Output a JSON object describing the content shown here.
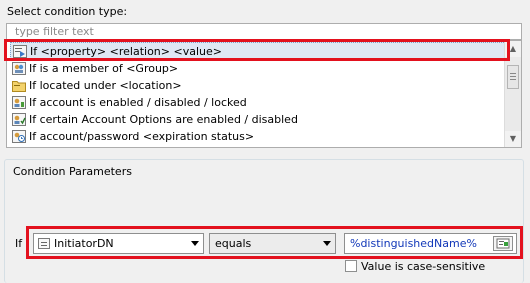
{
  "condition_type": {
    "label": "Select condition type:",
    "filter_placeholder": "type filter text",
    "items": [
      {
        "label": "If <property> <relation> <value>",
        "icon": "property-condition-icon",
        "selected": true
      },
      {
        "label": "If is a member of <Group>",
        "icon": "group-membership-icon",
        "selected": false
      },
      {
        "label": "If located under <location>",
        "icon": "folder-location-icon",
        "selected": false
      },
      {
        "label": "If account is enabled / disabled / locked",
        "icon": "account-state-icon",
        "selected": false
      },
      {
        "label": "If certain Account Options are enabled / disabled",
        "icon": "account-options-icon",
        "selected": false
      },
      {
        "label": "If account/password <expiration status>",
        "icon": "expiration-clock-icon",
        "selected": false
      }
    ]
  },
  "parameters": {
    "group_title": "Condition Parameters",
    "if_label": "If",
    "property": "InitiatorDN",
    "relation": "equals",
    "value": "%distinguishedName%",
    "case_sensitive_label": "Value is case-sensitive",
    "case_sensitive_checked": false
  },
  "colors": {
    "highlight_ring": "#e3111e",
    "value_text": "#1238b9",
    "selection_bg": "#dfe8f4"
  }
}
